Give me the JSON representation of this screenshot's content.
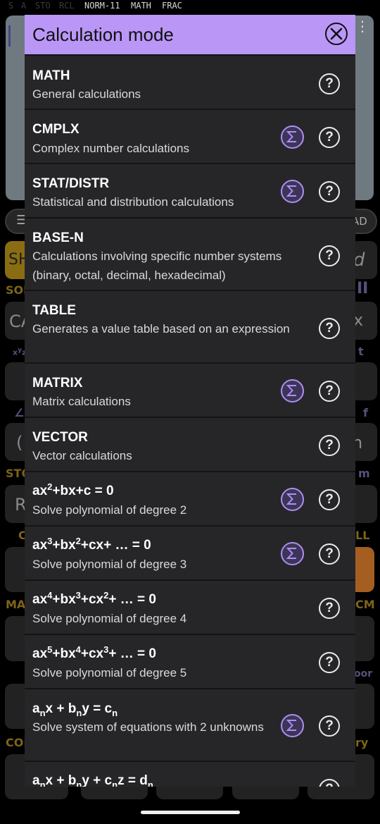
{
  "status": {
    "indicators_dim": [
      "S",
      "A",
      "STO",
      "RCL"
    ],
    "indicators_on": [
      "NORM-11",
      "MATH",
      "FRAC"
    ]
  },
  "background": {
    "visible_labels": [
      "SH",
      "d",
      "SOL",
      "II",
      "CA",
      "x",
      "t",
      "f",
      "∠",
      "(",
      "n",
      "STO",
      "m",
      "R",
      "LL",
      "C",
      "MAT",
      "CM",
      "oor",
      "COP",
      "ry",
      "AD"
    ]
  },
  "modal": {
    "title": "Calculation mode",
    "close_icon": "close-circle-icon",
    "help_label": "?",
    "sum_icon": "sigma-circle-icon",
    "items": [
      {
        "title": "MATH",
        "desc": "General calculations",
        "has_sum": false
      },
      {
        "title": "CMPLX",
        "desc": "Complex number calculations",
        "has_sum": true
      },
      {
        "title": "STAT/DISTR",
        "desc": "Statistical and distribution calculations",
        "has_sum": true
      },
      {
        "title": "BASE-N",
        "desc": "Calculations involving specific number systems (binary, octal, decimal, hexadecimal)",
        "has_sum": false
      },
      {
        "title": "TABLE",
        "desc": "Generates a value table based on an expression",
        "has_sum": false
      },
      {
        "title": "MATRIX",
        "desc": "Matrix calculations",
        "has_sum": true
      },
      {
        "title": "VECTOR",
        "desc": "Vector calculations",
        "has_sum": false
      },
      {
        "title_parts": [
          "ax",
          "2",
          "+bx+c = 0"
        ],
        "desc": "Solve polynomial of degree 2",
        "has_sum": true
      },
      {
        "title_parts": [
          "ax",
          "3",
          "+bx",
          "2",
          "+cx+ … = 0"
        ],
        "desc": "Solve polynomial of degree 3",
        "has_sum": true
      },
      {
        "title_parts": [
          "ax",
          "4",
          "+bx",
          "3",
          "+cx",
          "2",
          "+ … = 0"
        ],
        "desc": "Solve polynomial of degree 4",
        "has_sum": false
      },
      {
        "title_parts": [
          "ax",
          "5",
          "+bx",
          "4",
          "+cx",
          "3",
          "+ … = 0"
        ],
        "desc": "Solve polynomial of degree 5",
        "has_sum": false
      },
      {
        "title_parts": [
          "a",
          "n",
          "x + b",
          "n",
          "y = c",
          "n"
        ],
        "desc": "Solve system of equations with 2 unknowns",
        "has_sum": true
      },
      {
        "title_parts": [
          "a",
          "n",
          "x + b",
          "n",
          "y + c",
          "n",
          "z = d",
          "n"
        ],
        "desc": "",
        "has_sum": false
      }
    ]
  }
}
